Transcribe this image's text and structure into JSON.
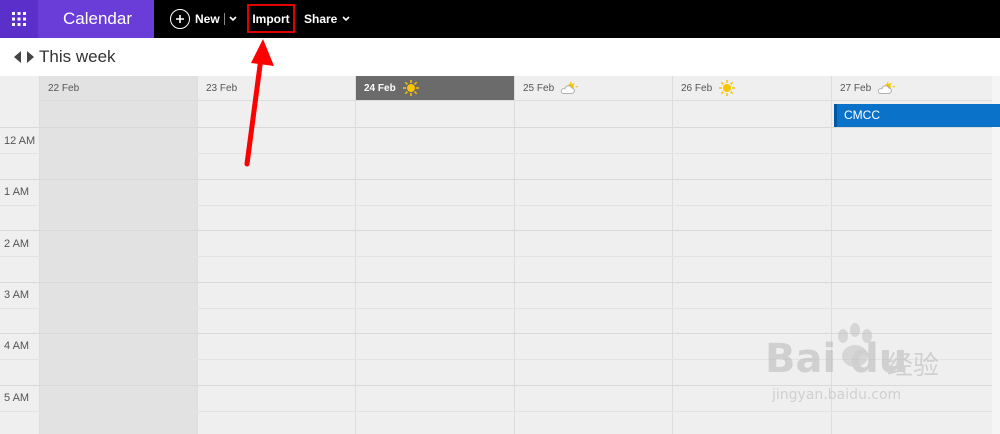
{
  "app": {
    "name": "Calendar"
  },
  "toolbar": {
    "new_label": "New",
    "import_label": "Import",
    "share_label": "Share"
  },
  "nav": {
    "week_title": "This week"
  },
  "days": [
    {
      "label": "22 Feb",
      "weather": ""
    },
    {
      "label": "23 Feb",
      "weather": ""
    },
    {
      "label": "24 Feb",
      "weather": "sun-icon",
      "today": true
    },
    {
      "label": "25 Feb",
      "weather": "partly-cloudy-icon"
    },
    {
      "label": "26 Feb",
      "weather": "sun-icon"
    },
    {
      "label": "27 Feb",
      "weather": "partly-cloudy-icon"
    }
  ],
  "times": [
    "12 AM",
    "1 AM",
    "2 AM",
    "3 AM",
    "4 AM",
    "5 AM"
  ],
  "event": {
    "title": "CMCC",
    "day": "27 Feb"
  },
  "watermark": {
    "brand": "Bai du",
    "cn": "经验",
    "url": "jingyan.baidu.com"
  },
  "colors": {
    "brand": "#6a3dd8",
    "event": "#0b72c9",
    "highlight": "#e00000"
  }
}
